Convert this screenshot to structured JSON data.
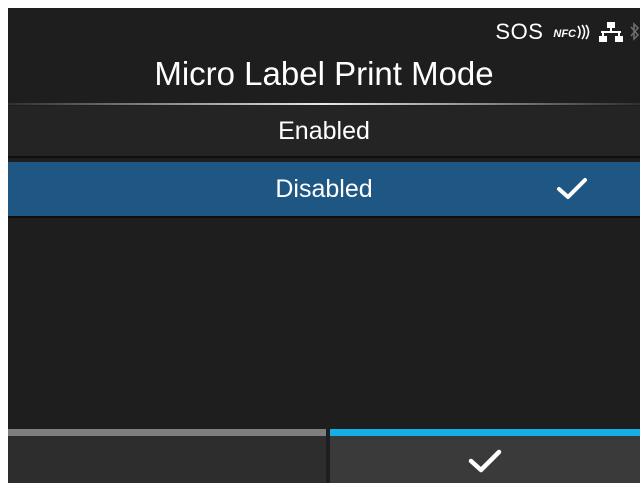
{
  "status_bar": {
    "sos_label": "SOS",
    "nfc_label": "NFC",
    "icons": [
      "nfc-icon",
      "network-icon",
      "bluetooth-icon"
    ]
  },
  "title": "Micro Label Print Mode",
  "options": [
    {
      "label": "Enabled",
      "selected": false
    },
    {
      "label": "Disabled",
      "selected": true
    }
  ],
  "footer": {
    "left_button": "",
    "right_button_icon": "checkmark-icon"
  },
  "colors": {
    "background": "#1e1e1e",
    "selected_row": "#1f5784",
    "confirm_accent": "#15aee6",
    "left_accent": "#7e7e7e"
  }
}
